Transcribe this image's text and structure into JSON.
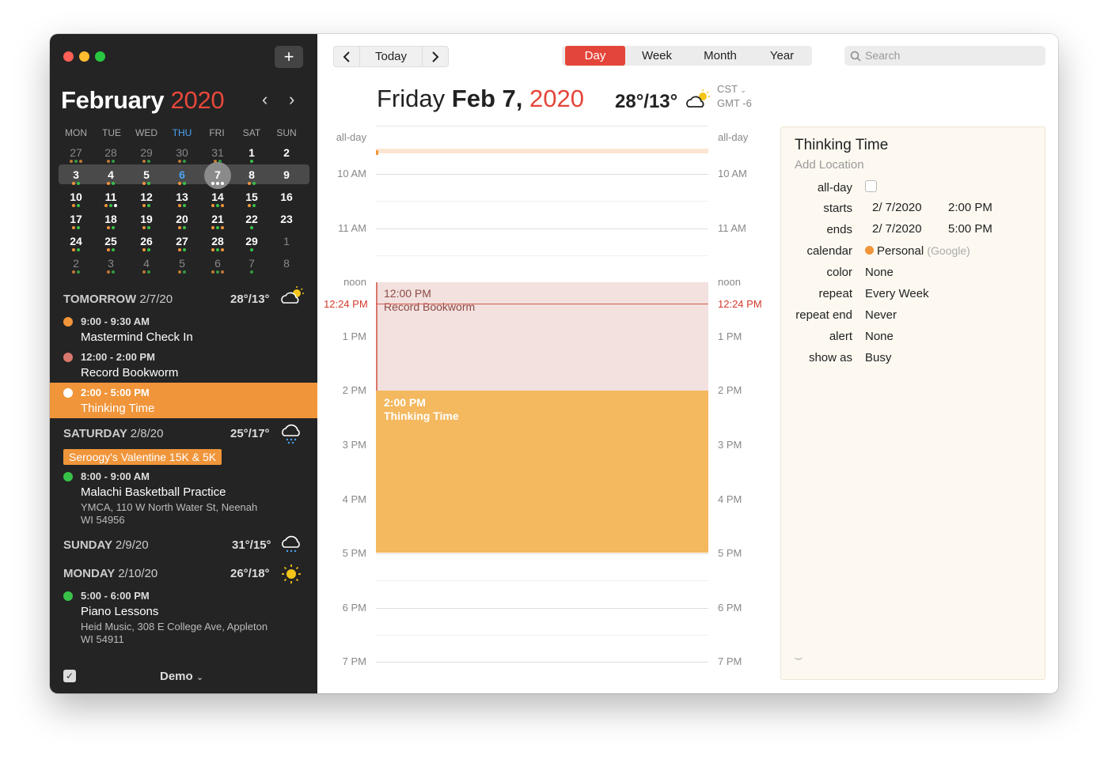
{
  "sidebar": {
    "month": "February",
    "year": "2020",
    "weekdays": [
      "MON",
      "TUE",
      "WED",
      "THU",
      "FRI",
      "SAT",
      "SUN"
    ],
    "weeks": [
      [
        "27",
        "28",
        "29",
        "30",
        "31",
        "1",
        "2"
      ],
      [
        "3",
        "4",
        "5",
        "6",
        "7",
        "8",
        "9"
      ],
      [
        "10",
        "11",
        "12",
        "13",
        "14",
        "15",
        "16"
      ],
      [
        "17",
        "18",
        "19",
        "20",
        "21",
        "22",
        "23"
      ],
      [
        "24",
        "25",
        "26",
        "27",
        "28",
        "29",
        "1"
      ],
      [
        "2",
        "3",
        "4",
        "5",
        "6",
        "7",
        "8"
      ]
    ],
    "sections": {
      "tomorrow": {
        "label": "TOMORROW",
        "date": "2/7/20",
        "temp": "28°/13°"
      },
      "saturday": {
        "label": "SATURDAY",
        "date": "2/8/20",
        "temp": "25°/17°"
      },
      "sunday": {
        "label": "SUNDAY",
        "date": "2/9/20",
        "temp": "31°/15°"
      },
      "monday": {
        "label": "MONDAY",
        "date": "2/10/20",
        "temp": "26°/18°"
      }
    },
    "events": [
      {
        "time": "9:00 - 9:30 AM",
        "title": "Mastermind Check In",
        "color": "#f0953a"
      },
      {
        "time": "12:00 - 2:00 PM",
        "title": "Record Bookworm",
        "color": "#d9776d"
      },
      {
        "time": "2:00 - 5:00 PM",
        "title": "Thinking Time",
        "color": "#ffffff"
      },
      {
        "time": "8:00 - 9:00 AM",
        "title": "Malachi Basketball Practice",
        "location": "YMCA, 110 W North Water St, Neenah WI 54956",
        "color": "#38c149"
      },
      {
        "time": "5:00 - 6:00 PM",
        "title": "Piano Lessons",
        "location": "Heid Music, 308 E College Ave, Appleton WI 54911",
        "color": "#38c149"
      }
    ],
    "allday_badge": "Seroogy's Valentine 15K & 5K",
    "calendar_set": "Demo"
  },
  "toolbar": {
    "prev_icon": "chevron-left-icon",
    "today_label": "Today",
    "next_icon": "chevron-right-icon",
    "views": [
      "Day",
      "Week",
      "Month",
      "Year"
    ],
    "active_view": "Day",
    "search_placeholder": "Search"
  },
  "day_header": {
    "weekday": "Friday",
    "date": "Feb 7,",
    "year": "2020",
    "temp": "28°/13°",
    "tz": "CST",
    "gmt": "GMT -6"
  },
  "timeline": {
    "allday_label": "all-day",
    "hours": [
      "10 AM",
      "11 AM",
      "noon",
      "1 PM",
      "2 PM",
      "3 PM",
      "4 PM",
      "5 PM",
      "6 PM",
      "7 PM"
    ],
    "now_label": "12:24 PM",
    "events": [
      {
        "time": "12:00 PM",
        "title": "Record Bookworm"
      },
      {
        "time": "2:00 PM",
        "title": "Thinking Time"
      }
    ]
  },
  "detail": {
    "title": "Thinking Time",
    "location_placeholder": "Add Location",
    "fields": {
      "allday": "all-day",
      "starts_label": "starts",
      "starts_date": "2/  7/2020",
      "starts_time": "2:00 PM",
      "ends_label": "ends",
      "ends_date": "2/  7/2020",
      "ends_time": "5:00 PM",
      "calendar_label": "calendar",
      "calendar_value": "Personal",
      "calendar_source": "(Google)",
      "color_label": "color",
      "color_value": "None",
      "repeat_label": "repeat",
      "repeat_value": "Every Week",
      "repeat_end_label": "repeat end",
      "repeat_end_value": "Never",
      "alert_label": "alert",
      "alert_value": "None",
      "show_as_label": "show as",
      "show_as_value": "Busy"
    }
  },
  "colors": {
    "accent": "#e4453a",
    "orange": "#f0953a",
    "green": "#38c149",
    "salmon": "#d9776d",
    "today_blue": "#4aa3f5"
  }
}
